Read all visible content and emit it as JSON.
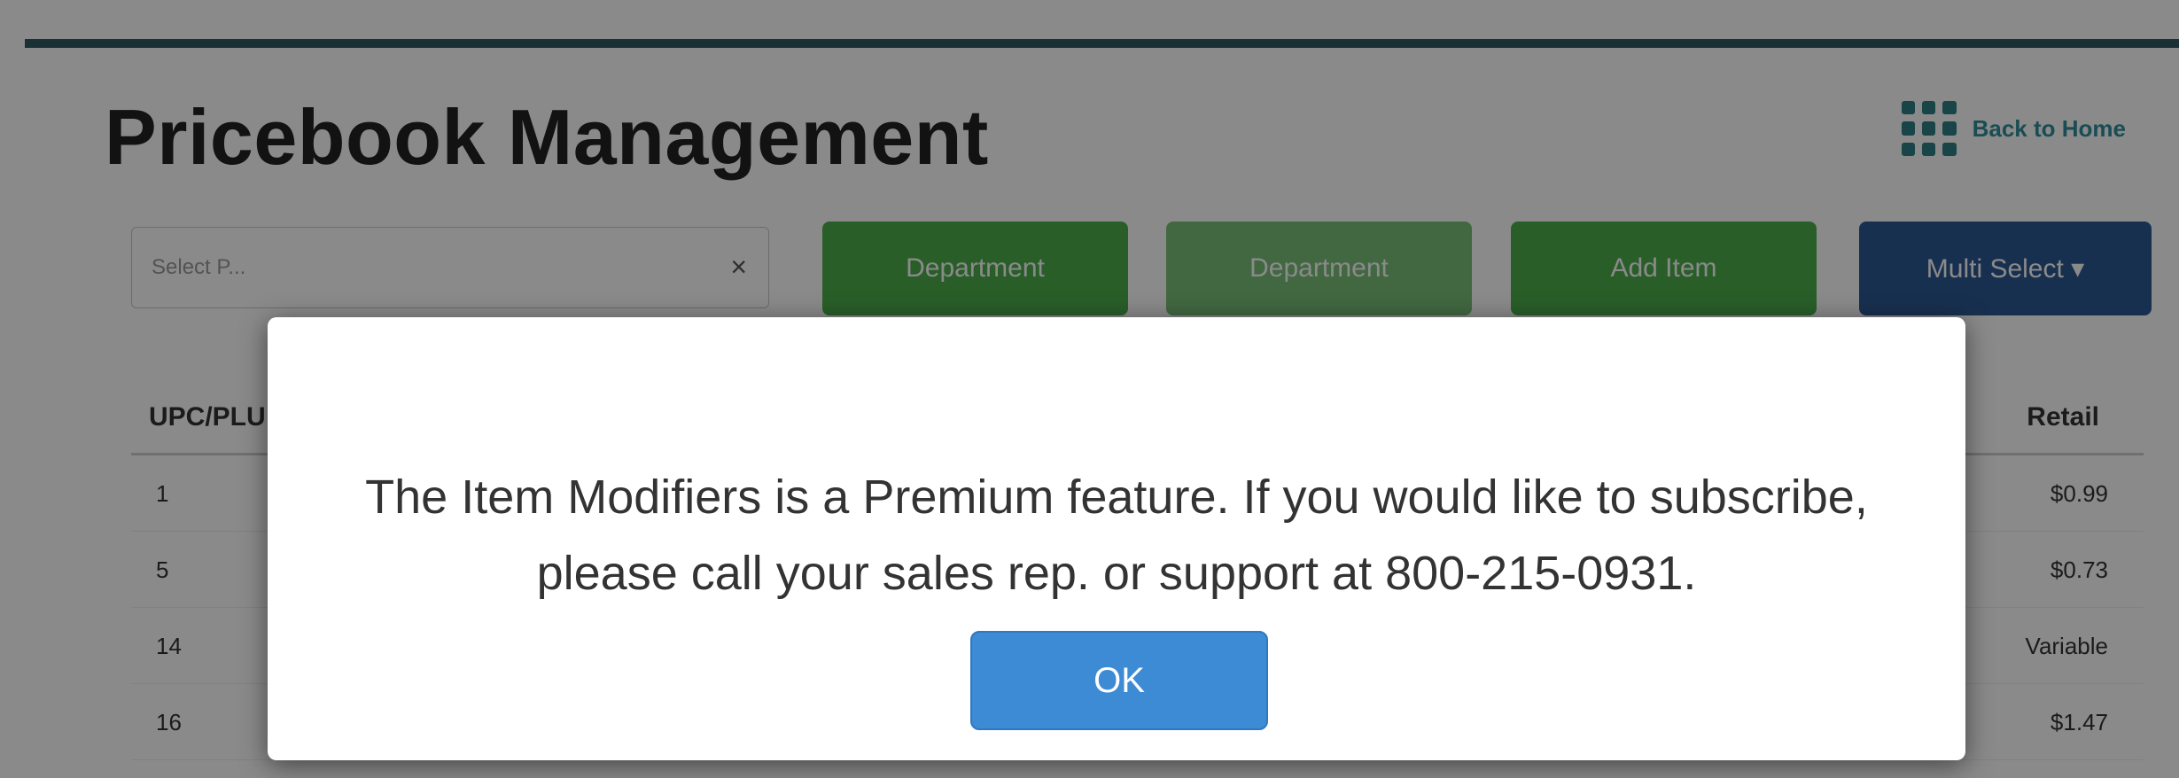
{
  "page": {
    "title": "Pricebook Management",
    "back_link": "Back to Home"
  },
  "toolbar": {
    "select_placeholder": "Select P...",
    "select_clear": "×",
    "buttons": [
      "Department",
      "Department",
      "Add Item",
      "Multi Select ▾"
    ]
  },
  "table": {
    "header_left": "UPC/PLU",
    "header_right": "Retail",
    "rows": [
      {
        "left": "1",
        "right": "$0.99"
      },
      {
        "left": "5",
        "right": "$0.73"
      },
      {
        "left": "14",
        "right": "Variable"
      },
      {
        "left": "16",
        "right": "$1.47"
      }
    ]
  },
  "modal": {
    "message_line1": "The Item Modifiers is a Premium feature. If you would like to subscribe,",
    "message_line2": "please call your sales rep. or support at 800-215-0931.",
    "ok_label": "OK"
  },
  "colors": {
    "accent_teal": "#2f5a63",
    "green": "#4cae4c",
    "blue": "#2d5a93",
    "ok_blue": "#3d8bd5"
  }
}
